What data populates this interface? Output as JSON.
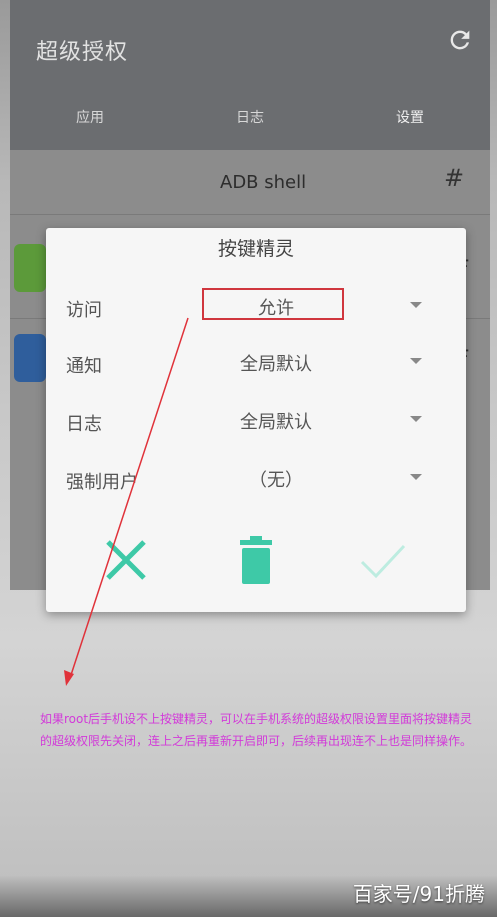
{
  "app": {
    "title": "超级授权",
    "tabs": [
      "应用",
      "日志",
      "设置"
    ]
  },
  "list": {
    "adb_label": "ADB shell",
    "hash": "#"
  },
  "dialog": {
    "title": "按键精灵",
    "rows": [
      {
        "label": "访问",
        "value": "允许"
      },
      {
        "label": "通知",
        "value": "全局默认"
      },
      {
        "label": "日志",
        "value": "全局默认"
      },
      {
        "label": "强制用户",
        "value": "（无）"
      }
    ]
  },
  "annotation": {
    "text": "如果root后手机设不上按键精灵，可以在手机系统的超级权限设置里面将按键精灵的超级权限先关闭，连上之后再重新开启即可，后续再出现连不上也是同样操作。"
  },
  "watermark": "百家号/91折腾",
  "colors": {
    "accent": "#3ec9a7",
    "highlight": "#d0363e",
    "annotation": "#d23ad9"
  },
  "icons": {
    "refresh": "refresh-icon",
    "cancel": "close-icon",
    "delete": "trash-icon",
    "confirm": "check-icon"
  }
}
